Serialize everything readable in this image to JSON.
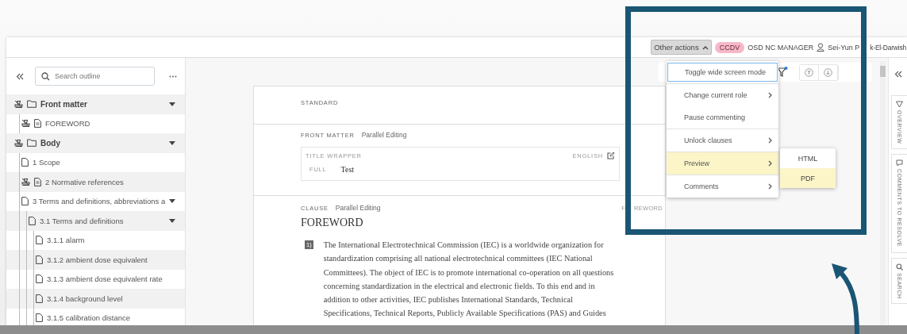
{
  "top_bar": {
    "actions_button": "Other actions",
    "role_badge": "CCDV",
    "role": "OSD NC MANAGER",
    "user": [
      "Sei-Yun P",
      "k-El-Darwish"
    ]
  },
  "outline": {
    "search": {
      "placeholder": "Search outline"
    },
    "tree": [
      {
        "label": "Front matter",
        "kind": "folder",
        "stamp": true,
        "expanded": true,
        "children": [
          {
            "label": "FOREWORD",
            "kind": "text-page",
            "stamp": true
          }
        ]
      },
      {
        "label": "Body",
        "kind": "folder",
        "stamp": true,
        "expanded": true,
        "children": [
          {
            "label": "1 Scope",
            "kind": "page",
            "stamp": false
          },
          {
            "label": "2 Normative references",
            "kind": "text-page",
            "stamp": true
          },
          {
            "label": "3 Terms and definitions, abbreviations a",
            "kind": "page",
            "stamp": false,
            "expanded": true,
            "children": [
              {
                "label": "3.1 Terms and definitions",
                "kind": "page",
                "stamp": false,
                "expanded": true,
                "children": [
                  {
                    "label": "3.1.1 alarm",
                    "kind": "page",
                    "stamp": false
                  },
                  {
                    "label": "3.1.2 ambient dose equivalent",
                    "kind": "page",
                    "stamp": false
                  },
                  {
                    "label": "3.1.3 ambient dose equivalent rate",
                    "kind": "page",
                    "stamp": false
                  },
                  {
                    "label": "3.1.4 background level",
                    "kind": "page",
                    "stamp": false
                  },
                  {
                    "label": "3.1.5 calibration distance",
                    "kind": "page",
                    "stamp": false
                  }
                ]
              }
            ]
          }
        ]
      }
    ]
  },
  "document": {
    "sections": [
      {
        "kind": "standard",
        "label": "STANDARD"
      },
      {
        "kind": "front_matter",
        "label": "FRONT MATTER",
        "mode": "Parallel Editing",
        "wrapper": {
          "label": "TITLE WRAPPER",
          "language": "ENGLISH",
          "field_label": "FULL",
          "value": "Test"
        }
      },
      {
        "kind": "clause",
        "label": "CLAUSE",
        "mode": "Parallel Editing",
        "tag": [
          "F",
          "REWORD"
        ],
        "title": "FOREWORD",
        "paragraphs": [
          {
            "number": "1)",
            "text": "The International Electrotechnical Commission (IEC) is a worldwide organization for standardization comprising all national electrotechnical committees (IEC National Committees). The object of IEC is to promote international co-operation on all questions concerning standardization in the electrical and electronic fields. To this end and in addition to other activities, IEC publishes International Standards, Technical Specifications, Technical Reports, Publicly Available Specifications (PAS) and Guides"
          }
        ]
      }
    ]
  },
  "menu": {
    "groups": [
      {
        "items": [
          {
            "label": "Toggle wide screen mode",
            "submenu": false,
            "focused": true,
            "selected": false
          }
        ]
      },
      {
        "items": [
          {
            "label": "Change current role",
            "submenu": true,
            "focused": false,
            "selected": false
          },
          {
            "label": "Pause commenting",
            "submenu": false,
            "focused": false,
            "selected": false
          }
        ]
      },
      {
        "items": [
          {
            "label": "Unlock clauses",
            "submenu": true,
            "focused": false,
            "selected": false
          }
        ]
      },
      {
        "items": [
          {
            "label": "Preview",
            "submenu": true,
            "focused": false,
            "selected": true
          }
        ]
      },
      {
        "items": [
          {
            "label": "Comments",
            "submenu": true,
            "focused": false,
            "selected": false
          }
        ]
      }
    ],
    "submenu": [
      {
        "label": "HTML",
        "selected": false
      },
      {
        "label": "PDF",
        "selected": true
      }
    ]
  },
  "right_panel": {
    "tabs": [
      {
        "label": "OVERVIEW",
        "kind": "overview"
      },
      {
        "label": "COMMENTS TO RESOLVE",
        "kind": "comments"
      },
      {
        "label": "SEARCH",
        "kind": "search"
      }
    ]
  }
}
